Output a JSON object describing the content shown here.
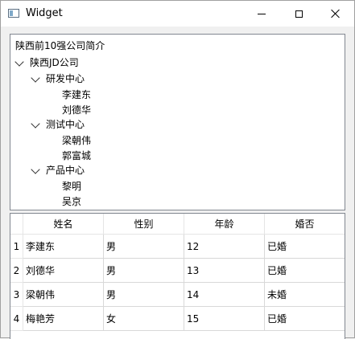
{
  "window": {
    "title": "Widget",
    "icon": "app-window-icon"
  },
  "tree": {
    "header": "陕西前10强公司简介",
    "root": {
      "label": "陕西JD公司",
      "children": [
        {
          "label": "研发中心",
          "members": [
            "李建东",
            "刘德华"
          ]
        },
        {
          "label": "测试中心",
          "members": [
            "梁朝伟",
            "郭富城"
          ]
        },
        {
          "label": "产品中心",
          "members": [
            "黎明",
            "吴京"
          ]
        }
      ]
    }
  },
  "table": {
    "columns": [
      "姓名",
      "性别",
      "年龄",
      "婚否"
    ],
    "row_numbers": [
      "1",
      "2",
      "3",
      "4"
    ],
    "rows": [
      [
        "李建东",
        "男",
        "12",
        "已婚"
      ],
      [
        "刘德华",
        "男",
        "13",
        "已婚"
      ],
      [
        "梁朝伟",
        "男",
        "14",
        "未婚"
      ],
      [
        "梅艳芳",
        "女",
        "15",
        "已婚"
      ]
    ]
  }
}
